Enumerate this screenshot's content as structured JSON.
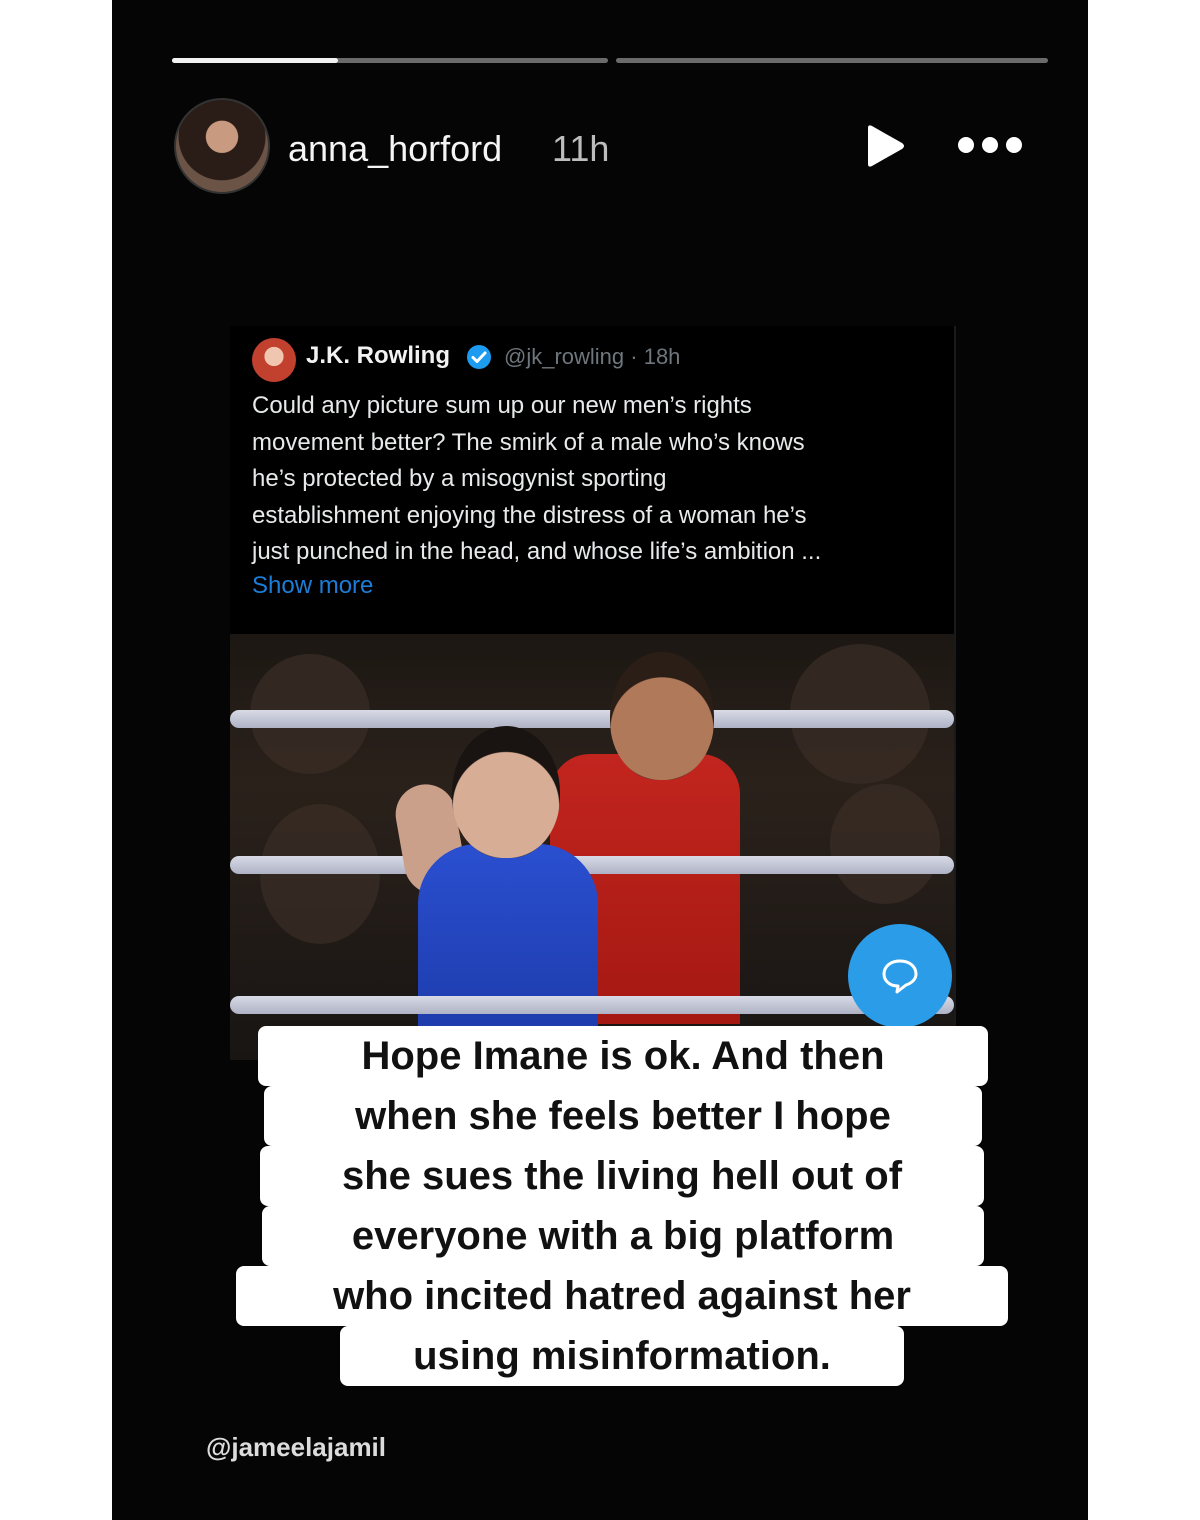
{
  "story": {
    "progress_segments": [
      {
        "filled": 0.38
      },
      {
        "filled": 0.0
      }
    ],
    "header": {
      "username": "anna_horford",
      "time_ago": "11h",
      "play_icon": "play-icon",
      "more_icon": "more-dots-icon"
    },
    "shared_post": {
      "author_name": "J.K. Rowling",
      "verified_icon": "verified-check-icon",
      "meta": "@jk_rowling · 18h",
      "text_lines": [
        "Could any picture sum up our new men’s rights",
        "movement better? The smirk of a male who’s knows",
        "he’s protected by a misogynist sporting",
        "establishment enjoying the distress of a woman he’s",
        "just punched in the head, and whose life’s ambition ..."
      ],
      "show_more": "Show more",
      "photo_icon": "boxing-photo"
    },
    "reply_icon": "speech-bubble-icon",
    "caption_lines": [
      "Hope Imane is ok. And then",
      "when she feels better I hope",
      "she sues the living hell out of",
      "everyone with a big platform",
      "who incited hatred against her",
      "using misinformation."
    ],
    "mention": "@jameelajamil"
  }
}
